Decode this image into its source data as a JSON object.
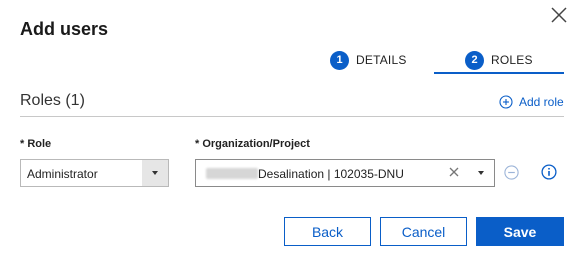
{
  "dialog": {
    "title": "Add users"
  },
  "steps": [
    {
      "number": "1",
      "label": "DETAILS"
    },
    {
      "number": "2",
      "label": "ROLES"
    }
  ],
  "roles_section": {
    "title": "Roles (1)",
    "add_role_label": "Add role"
  },
  "form": {
    "role_label": "* Role",
    "role_value": "Administrator",
    "org_label": "* Organization/Project",
    "org_value": "Desalination | 102035-DNU"
  },
  "buttons": {
    "back": "Back",
    "cancel": "Cancel",
    "save": "Save"
  },
  "colors": {
    "accent": "#0a5ec8"
  }
}
